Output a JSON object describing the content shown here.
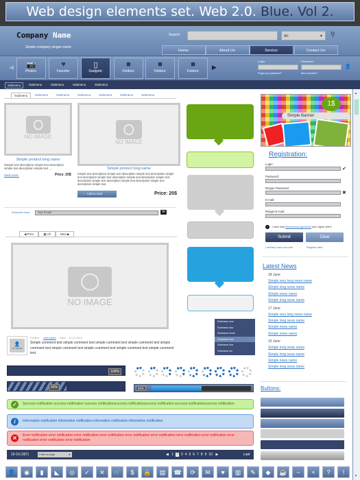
{
  "banner": {
    "title_main": "Web design elements set. Web 2.0.",
    "title_accent": "Blue. Vol 2."
  },
  "header": {
    "company_first": "Company",
    "company_second": "Name",
    "slogan": "Simple company slogan name",
    "search_label": "Search:",
    "search_value": "",
    "search_select": "All:",
    "nav": [
      "Home:",
      "About Us:",
      "Service:",
      "Contact Us:"
    ],
    "active_nav": 2
  },
  "iconbar": {
    "items": [
      {
        "label": "Photos:",
        "icon": "camera-icon",
        "glyph": "📷"
      },
      {
        "label": "Favorite:",
        "icon": "heart-icon",
        "glyph": "♥"
      },
      {
        "label": "Gadgets:",
        "icon": "gadget-icon",
        "glyph": "▯"
      },
      {
        "label": "Folders:",
        "icon": "folder-icon",
        "glyph": "■"
      },
      {
        "label": "Folders:",
        "icon": "folder-icon",
        "glyph": "■"
      },
      {
        "label": "Folders:",
        "icon": "folder-icon",
        "glyph": "■"
      }
    ],
    "active": 2,
    "login_label": "Login:",
    "password_label": "Password:",
    "forgot": "Forgot you password?",
    "not_member": "Not a member?"
  },
  "submenu_bar": [
    "Submenu",
    "Submenu",
    "Submenu",
    "Submenu",
    "Submenu"
  ],
  "tabs": [
    "Submenu",
    "Submenu",
    "Submenu",
    "Submenu",
    "Submenu",
    "Submenu",
    "Submenu"
  ],
  "products": {
    "no_image": "NO IMAGE",
    "p1": {
      "name": "Simple product long name",
      "desc": "Simple text description simple text description simple text description simple text ...",
      "read_more": "read more:",
      "price": "Price: 20$"
    },
    "p2": {
      "name": "Simple product long name",
      "desc": "Simple text description simple text description simple text description simple text description simple text description simple text description simple text description simple text description simple text description simple text description simple text.",
      "add_to_cart": "Add to Cart",
      "price": "Price: 20$"
    }
  },
  "subscribe": {
    "label": "Subscribe Now!",
    "placeholder": "Your E-mail"
  },
  "pager": {
    "prev": "◀ Prev",
    "all": "▦ All",
    "next": "Next ▶"
  },
  "dropdown": {
    "items": [
      "Submenu one",
      "Submenu two",
      "Submenu three",
      "Submenu four",
      "Submenu five",
      "Submenu six"
    ],
    "highlight": 3
  },
  "comment": {
    "avatar_text": "NO IMAGE",
    "posted_label": "Posted:",
    "username": "Username",
    "date_label": "Date:",
    "date": "12.12.2012",
    "text": "Simple comment text simple comment text  simple comment text simple comment text simple comment text simple comment text simple comment text simple comment text simple comment text."
  },
  "progress": {
    "bar1": {
      "label": "100%",
      "value": 100
    },
    "bar2": {
      "label": "50%",
      "value": 50
    },
    "bar3": {
      "label": "50%",
      "value": 50
    },
    "spinner_steps": 9
  },
  "notifications": {
    "success": "Success notification success notification success notificationsuccess notificationsuccess notification-success notificationsuccess notification",
    "info": "Information notification information notification information notification information notification",
    "error": "Error notification error notification error notification error notification error notification error notification error notification error notification error notification error notification error notification"
  },
  "pagination": {
    "range": "10-19 (367)",
    "per_page": "9 item on page",
    "pages": [
      "1",
      "2",
      "3",
      "4",
      "5",
      "6",
      "7",
      "8",
      "9",
      "10"
    ],
    "current": "2",
    "last": "Last"
  },
  "bottom_icons": [
    "user-icon",
    "eye-icon",
    "chart-icon",
    "rss-icon",
    "globe-icon",
    "check-icon",
    "close-icon",
    "cart-icon",
    "dollar-icon",
    "lock-icon",
    "trash-icon",
    "phone-icon",
    "refresh-icon",
    "mail-icon",
    "heart-icon",
    "bin-icon",
    "pin-icon",
    "tag-icon",
    "cup-icon",
    "minus-icon",
    "plus-icon",
    "question-icon",
    "exclamation-icon"
  ],
  "bottom_glyphs": [
    "👤",
    "◉",
    "▮",
    "◣",
    "◎",
    "✓",
    "✕",
    "🛒",
    "$",
    "🔒",
    "▤",
    "☎",
    "⟳",
    "✉",
    "♥",
    "▥",
    "✎",
    "◆",
    "☕",
    "−",
    "+",
    "?",
    "!"
  ],
  "banner_ad": {
    "price": "1$",
    "label": "Simple Banner"
  },
  "registration": {
    "title": "Registration:",
    "login": "Login:",
    "password": "Password:",
    "retype_password": "Retype Password:",
    "email": "E-mail:",
    "retype_email": "Retype E-mail:",
    "agree_pre": "I have read",
    "agreement": "Membership Agreement",
    "agree_post": "and I agree with it",
    "submit": "Submit",
    "clear": "Clear",
    "have_account": "I already have account",
    "register_later": "Register later"
  },
  "news": {
    "title": "Latest News",
    "groups": [
      {
        "date": "18 June",
        "items": [
          "Simple very long news name",
          "Simple long news name",
          "Simple news name",
          "Simple long news name"
        ]
      },
      {
        "date": "17 June",
        "items": [
          "Simple very long news name",
          "Simple long news name",
          "Simple news name",
          "Simple news name"
        ]
      },
      {
        "date": "16 June",
        "items": [
          "Simple long news name",
          "Simple long news name",
          "Simple news name",
          "Simple long news name"
        ]
      }
    ]
  },
  "buttons": {
    "title": "Buttons:"
  },
  "colors": {
    "brand": "#6583ae",
    "dark": "#2e3d5f",
    "link": "#3578c4",
    "success": "#c7f0a0",
    "info": "#c4daf5",
    "error": "#f8b7b7"
  }
}
